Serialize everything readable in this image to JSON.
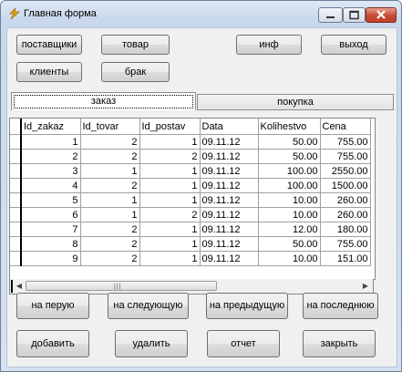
{
  "window": {
    "title": "Главная форма"
  },
  "top_buttons": {
    "suppliers": "поставщики",
    "product": "товар",
    "info": "инф",
    "exit": "выход",
    "clients": "клиенты",
    "defect": "брак"
  },
  "tabs": {
    "order": "заказ",
    "purchase": "покупка"
  },
  "grid": {
    "columns": [
      "Id_zakaz",
      "Id_tovar",
      "Id_postav",
      "Data",
      "Kolihestvo",
      "Cena"
    ],
    "rows": [
      [
        "1",
        "2",
        "1",
        "09.11.12",
        "50.00",
        "755.00"
      ],
      [
        "2",
        "2",
        "2",
        "09.11.12",
        "50.00",
        "755.00"
      ],
      [
        "3",
        "1",
        "1",
        "09.11.12",
        "100.00",
        "2550.00"
      ],
      [
        "4",
        "2",
        "1",
        "09.11.12",
        "100.00",
        "1500.00"
      ],
      [
        "5",
        "1",
        "1",
        "09.11.12",
        "10.00",
        "260.00"
      ],
      [
        "6",
        "1",
        "2",
        "09.11.12",
        "10.00",
        "260.00"
      ],
      [
        "7",
        "2",
        "1",
        "09.11.12",
        "12.00",
        "180.00"
      ],
      [
        "8",
        "2",
        "1",
        "09.11.12",
        "50.00",
        "755.00"
      ],
      [
        "9",
        "2",
        "1",
        "09.11.12",
        "10.00",
        "151.00"
      ]
    ]
  },
  "nav_buttons": {
    "first": "на перую",
    "next": "на следующую",
    "prev": "на предыдущую",
    "last": "на последнюю"
  },
  "action_buttons": {
    "add": "добавить",
    "delete": "удалить",
    "report": "отчет",
    "close": "закрыть"
  }
}
